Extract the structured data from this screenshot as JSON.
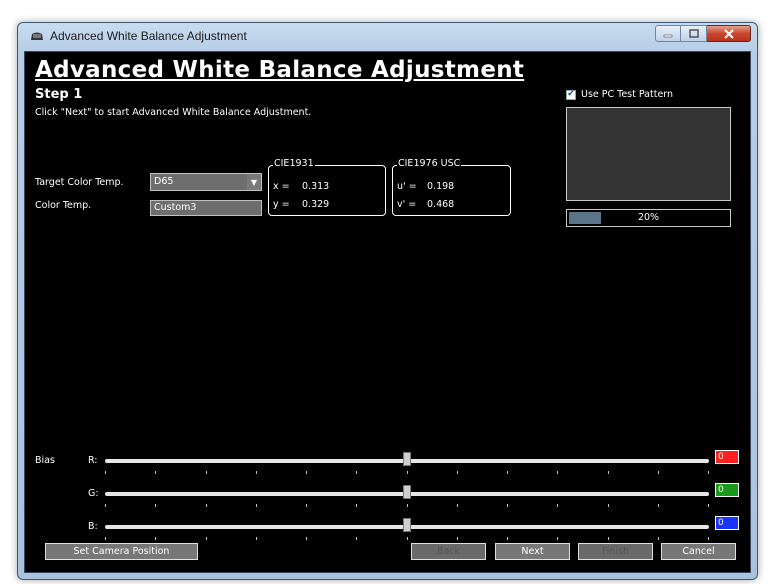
{
  "window": {
    "title": "Advanced White Balance Adjustment"
  },
  "main": {
    "heading": "Advanced White Balance Adjustment",
    "step": "Step 1",
    "instruction": "Click \"Next\" to start Advanced White Balance Adjustment."
  },
  "target": {
    "label": "Target Color Temp.",
    "selected": "D65",
    "color_temp_label": "Color Temp.",
    "color_temp_value": "Custom3"
  },
  "cie1931": {
    "title": "CIE1931",
    "x_label": "x =",
    "x_value": "0.313",
    "y_label": "y =",
    "y_value": "0.329"
  },
  "cie1976": {
    "title": "CIE1976 USC",
    "u_label": "u' =",
    "u_value": "0.198",
    "v_label": "v' =",
    "v_value": "0.468"
  },
  "test_pattern": {
    "label": "Use PC Test Pattern",
    "checked": true
  },
  "progress": {
    "value": 20,
    "text": "20%"
  },
  "bias": {
    "label": "Bias",
    "channels": [
      {
        "label": "R:",
        "value": "0",
        "color": "#ff1f1f",
        "level": 0.5
      },
      {
        "label": "G:",
        "value": "0",
        "color": "#1a9a1a",
        "level": 0.5
      },
      {
        "label": "B:",
        "value": "0",
        "color": "#1a33ff",
        "level": 0.5
      }
    ]
  },
  "buttons": {
    "set_camera": "Set Camera Position",
    "back": "Back",
    "next": "Next",
    "finish": "Finish",
    "cancel": "Cancel"
  }
}
